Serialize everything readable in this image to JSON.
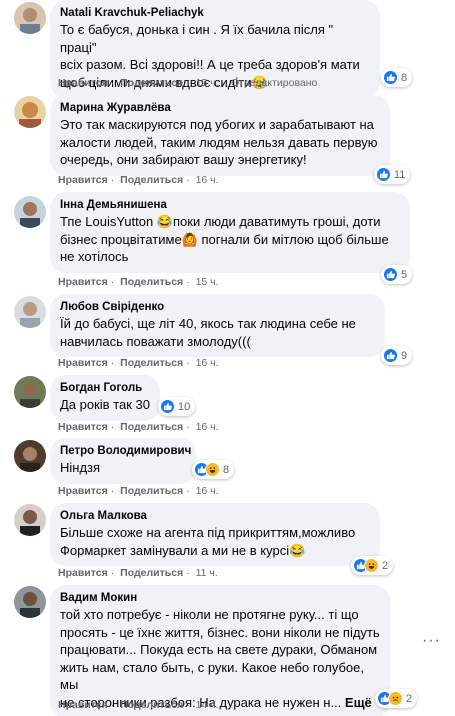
{
  "actions": {
    "like": "Нравится",
    "reply": "Поделиться",
    "edited": "Отредактировано"
  },
  "comments": [
    {
      "author": "Natali Kravchuk-Peliachyk",
      "lines": [
        "То є бабуся, донька і син . Я їх бачила після \" праці\"",
        "всіх разом. Всі здорові!! А це треба здоров'я мати",
        "щоб цілими днями вдвоє сидіти😪"
      ],
      "time": "15 ч.",
      "reactions": [
        "like"
      ],
      "count": "8"
    },
    {
      "author": "Марина Журавлёва",
      "lines": [
        "Это так маскируются под убогих и зарабатывают на",
        "жалости людей, таким людям нельзя давать первую",
        "очередь, они забирают вашу энергетику!"
      ],
      "time": "16 ч.",
      "reactions": [
        "like"
      ],
      "count": "11"
    },
    {
      "author": "Інна Демьянишена",
      "lines": [
        "Тпе LouisYutton 😂поки люди даватимуть гроші, доти",
        "бізнес процвітатиме🙆 погнали би мітлою щоб більше",
        "не хотілось"
      ],
      "time": "15 ч.",
      "reactions": [
        "like"
      ],
      "count": "5"
    },
    {
      "author": "Любов Свіріденко",
      "lines": [
        "Їй до бабусі, ще літ 40, якось так людина себе не",
        "навчилась поважати змолоду((("
      ],
      "time": "16 ч.",
      "reactions": [
        "like"
      ],
      "count": "9"
    },
    {
      "author": "Богдан Гоголь",
      "lines": [
        "Да років так 30"
      ],
      "time": "16 ч.",
      "reactions": [
        "like"
      ],
      "count": "10"
    },
    {
      "author": "Петро Володимирович",
      "lines": [
        "Ніндзя"
      ],
      "time": "16 ч.",
      "reactions": [
        "like",
        "haha"
      ],
      "count": "8"
    },
    {
      "author": "Ольга Малкова",
      "lines": [
        "Більше схоже на агента під прикриттям,можливо",
        "Формаркет замінували а ми не в курсі😂"
      ],
      "time": "11 ч.",
      "reactions": [
        "like",
        "haha"
      ],
      "count": "2"
    },
    {
      "author": "Вадим Мокин",
      "lines": [
        "той хто потребує - ніколи не протягне руку... ті що",
        "просять - це їхнє життя, бізнес. вони ніколи не підуть",
        "працювати... Покуда есть на свете дураки, Обманом",
        "жить нам, стало быть, с руки. Какое небо голубое, мы",
        "не сторонники разбоя: На дурака не нужен н... "
      ],
      "see_more": "Ещё",
      "time": "14 ч.",
      "reactions": [
        "like",
        "care"
      ],
      "count": "2"
    }
  ],
  "more_icon": "···",
  "colors": {
    "like": "#1877f2",
    "bubble": "#f0f2f5",
    "meta": "#65676b"
  }
}
